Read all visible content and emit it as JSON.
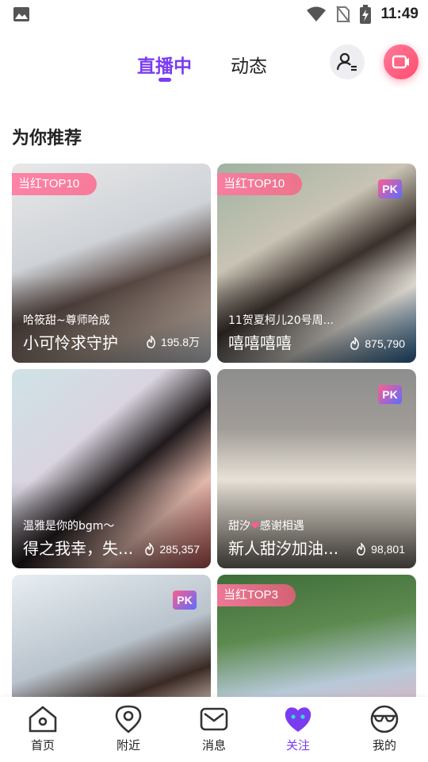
{
  "status_bar": {
    "time": "11:49",
    "icons": [
      "image-icon",
      "wifi-icon",
      "no-sim-icon",
      "battery-charging-icon"
    ]
  },
  "header": {
    "tabs": [
      {
        "label": "直播中",
        "active": true
      },
      {
        "label": "动态",
        "active": false
      }
    ],
    "actions": [
      "user-list-icon",
      "video-camera-icon"
    ]
  },
  "section": {
    "title": "为你推荐"
  },
  "cards": [
    {
      "badge": "当红TOP10",
      "pk": "",
      "anchor": "哈筱甜~尊师哈成",
      "title": "小可怜求守护",
      "viewers": "195.8万"
    },
    {
      "badge": "当红TOP10",
      "pk": "PK",
      "anchor": "11贺夏柯儿20号周...",
      "title": "嘻嘻嘻嘻",
      "viewers": "875,790"
    },
    {
      "badge": "",
      "pk": "",
      "anchor": "温雅是你的bgm〜",
      "title": "得之我幸，失...",
      "viewers": "285,357"
    },
    {
      "badge": "",
      "pk": "PK",
      "anchor": "甜汐",
      "anchor_heart": "❤",
      "anchor_suffix": "感谢相遇",
      "title": "新人甜汐加油...",
      "viewers": "98,801"
    },
    {
      "badge": "",
      "pk": "PK",
      "anchor": "",
      "title": "",
      "viewers": ""
    },
    {
      "badge": "当红TOP3",
      "pk": "",
      "anchor": "",
      "title": "",
      "viewers": ""
    }
  ],
  "bottom_nav": [
    {
      "label": "首页",
      "icon": "home-icon",
      "active": false
    },
    {
      "label": "附近",
      "icon": "location-pin-icon",
      "active": false
    },
    {
      "label": "消息",
      "icon": "mail-icon",
      "active": false
    },
    {
      "label": "关注",
      "icon": "heart-face-icon",
      "active": true
    },
    {
      "label": "我的",
      "icon": "glasses-face-icon",
      "active": false
    }
  ],
  "colors": {
    "accent": "#7a3cf0",
    "pink": "#ff4d6d"
  }
}
